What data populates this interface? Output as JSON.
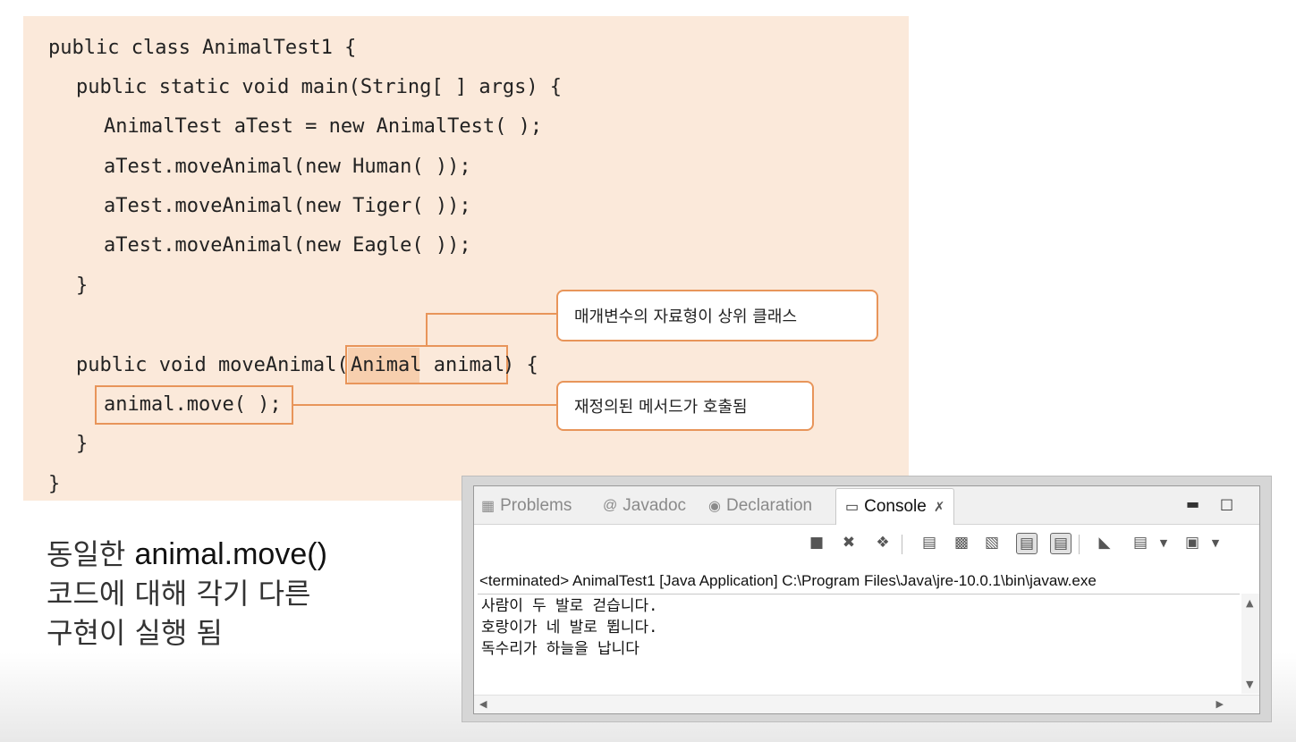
{
  "code": {
    "lines": [
      "public class AnimalTest1 {",
      "public static void main(String[ ] args) {",
      "AnimalTest aTest = new AnimalTest( );",
      "aTest.moveAnimal(new Human( ));",
      "aTest.moveAnimal(new Tiger( ));",
      "aTest.moveAnimal(new Eagle( ));",
      "}",
      "public void moveAnimal(",
      "Animal animal",
      ") {",
      "animal.move( );",
      "}",
      "}"
    ]
  },
  "callouts": {
    "param_type": "매개변수의 자료형이 상위 클래스",
    "overridden": "재정의된 메서드가 호출됨"
  },
  "explanation": {
    "line1_prefix": "동일한 ",
    "line1_code": "animal.move()",
    "line2": "코드에 대해 각기 다른",
    "line3": "구현이 실행 됨"
  },
  "console": {
    "tabs": {
      "problems": "Problems",
      "javadoc": "Javadoc",
      "declaration": "Declaration",
      "console": "Console"
    },
    "status": "<terminated> AnimalTest1 [Java Application] C:\\Program Files\\Java\\jre-10.0.1\\bin\\javaw.exe",
    "output": [
      "사람이 두 발로 걷습니다.",
      "호랑이가 네 발로 뜁니다.",
      "독수리가 하늘을 납니다"
    ]
  },
  "colors": {
    "code_bg": "#fbe9da",
    "accent_orange": "#e8955a"
  }
}
